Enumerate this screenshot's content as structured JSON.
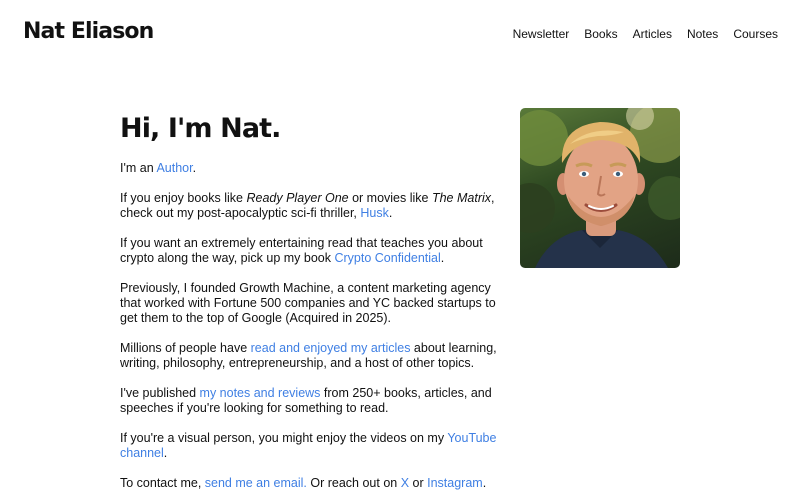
{
  "header": {
    "site_title": "Nat Eliason",
    "nav": [
      "Newsletter",
      "Books",
      "Articles",
      "Notes",
      "Courses"
    ]
  },
  "hero": {
    "title": "Hi, I'm Nat."
  },
  "paragraphs": {
    "p1": {
      "t1": "I'm an ",
      "link": "Author",
      "t2": "."
    },
    "p2": {
      "t1": "If you enjoy books like ",
      "em1": "Ready Player One",
      "t2": " or movies like ",
      "em2": "The Matrix",
      "t3": ", check out my post-apocalyptic sci-fi thriller, ",
      "link": "Husk",
      "t4": "."
    },
    "p3": {
      "t1": "If you want an extremely entertaining read that teaches you about crypto along the way, pick up my book ",
      "link": "Crypto Confidential",
      "t2": "."
    },
    "p4": {
      "t1": "Previously, I founded Growth Machine, a content marketing agency that worked with Fortune 500 companies and YC backed startups to get them to the top of Google (Acquired in 2025)."
    },
    "p5": {
      "t1": "Millions of people have ",
      "link": "read and enjoyed my articles",
      "t2": " about learning, writing, philosophy, entrepreneurship, and a host of other topics."
    },
    "p6": {
      "t1": "I've published ",
      "link": "my notes and reviews",
      "t2": " from 250+ books, articles, and speeches if you're looking for something to read."
    },
    "p7": {
      "t1": "If you're a visual person, you might enjoy the videos on my ",
      "link": "YouTube channel",
      "t2": "."
    },
    "p8": {
      "t1": "To contact me, ",
      "link1": "send me an email.",
      "t2": " Or reach out on ",
      "link2": "X",
      "t3": " or ",
      "link3": "Instagram",
      "t4": "."
    }
  },
  "colors": {
    "link": "#3f7fe3",
    "text": "#111111",
    "background": "#ffffff"
  }
}
